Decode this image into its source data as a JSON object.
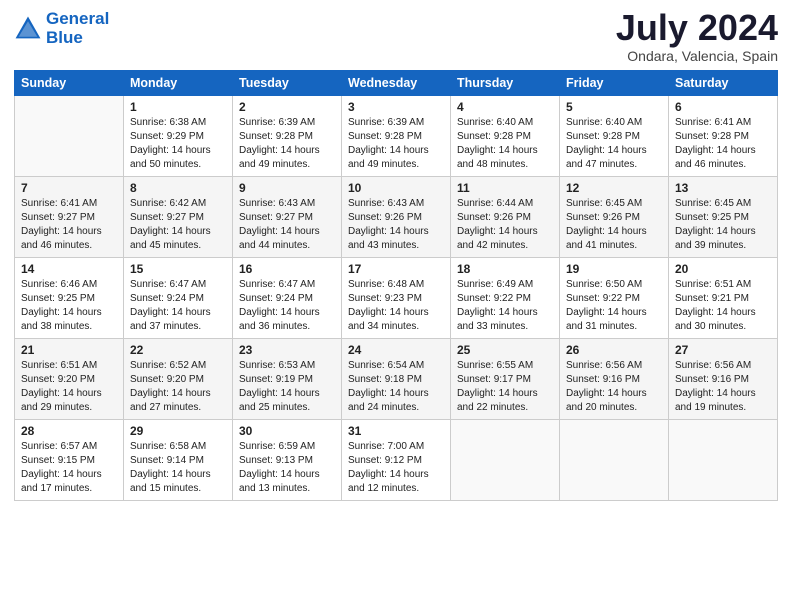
{
  "header": {
    "logo_line1": "General",
    "logo_line2": "Blue",
    "month": "July 2024",
    "location": "Ondara, Valencia, Spain"
  },
  "weekdays": [
    "Sunday",
    "Monday",
    "Tuesday",
    "Wednesday",
    "Thursday",
    "Friday",
    "Saturday"
  ],
  "weeks": [
    [
      {
        "day": "",
        "sunrise": "",
        "sunset": "",
        "daylight": ""
      },
      {
        "day": "1",
        "sunrise": "Sunrise: 6:38 AM",
        "sunset": "Sunset: 9:29 PM",
        "daylight": "Daylight: 14 hours and 50 minutes."
      },
      {
        "day": "2",
        "sunrise": "Sunrise: 6:39 AM",
        "sunset": "Sunset: 9:28 PM",
        "daylight": "Daylight: 14 hours and 49 minutes."
      },
      {
        "day": "3",
        "sunrise": "Sunrise: 6:39 AM",
        "sunset": "Sunset: 9:28 PM",
        "daylight": "Daylight: 14 hours and 49 minutes."
      },
      {
        "day": "4",
        "sunrise": "Sunrise: 6:40 AM",
        "sunset": "Sunset: 9:28 PM",
        "daylight": "Daylight: 14 hours and 48 minutes."
      },
      {
        "day": "5",
        "sunrise": "Sunrise: 6:40 AM",
        "sunset": "Sunset: 9:28 PM",
        "daylight": "Daylight: 14 hours and 47 minutes."
      },
      {
        "day": "6",
        "sunrise": "Sunrise: 6:41 AM",
        "sunset": "Sunset: 9:28 PM",
        "daylight": "Daylight: 14 hours and 46 minutes."
      }
    ],
    [
      {
        "day": "7",
        "sunrise": "Sunrise: 6:41 AM",
        "sunset": "Sunset: 9:27 PM",
        "daylight": "Daylight: 14 hours and 46 minutes."
      },
      {
        "day": "8",
        "sunrise": "Sunrise: 6:42 AM",
        "sunset": "Sunset: 9:27 PM",
        "daylight": "Daylight: 14 hours and 45 minutes."
      },
      {
        "day": "9",
        "sunrise": "Sunrise: 6:43 AM",
        "sunset": "Sunset: 9:27 PM",
        "daylight": "Daylight: 14 hours and 44 minutes."
      },
      {
        "day": "10",
        "sunrise": "Sunrise: 6:43 AM",
        "sunset": "Sunset: 9:26 PM",
        "daylight": "Daylight: 14 hours and 43 minutes."
      },
      {
        "day": "11",
        "sunrise": "Sunrise: 6:44 AM",
        "sunset": "Sunset: 9:26 PM",
        "daylight": "Daylight: 14 hours and 42 minutes."
      },
      {
        "day": "12",
        "sunrise": "Sunrise: 6:45 AM",
        "sunset": "Sunset: 9:26 PM",
        "daylight": "Daylight: 14 hours and 41 minutes."
      },
      {
        "day": "13",
        "sunrise": "Sunrise: 6:45 AM",
        "sunset": "Sunset: 9:25 PM",
        "daylight": "Daylight: 14 hours and 39 minutes."
      }
    ],
    [
      {
        "day": "14",
        "sunrise": "Sunrise: 6:46 AM",
        "sunset": "Sunset: 9:25 PM",
        "daylight": "Daylight: 14 hours and 38 minutes."
      },
      {
        "day": "15",
        "sunrise": "Sunrise: 6:47 AM",
        "sunset": "Sunset: 9:24 PM",
        "daylight": "Daylight: 14 hours and 37 minutes."
      },
      {
        "day": "16",
        "sunrise": "Sunrise: 6:47 AM",
        "sunset": "Sunset: 9:24 PM",
        "daylight": "Daylight: 14 hours and 36 minutes."
      },
      {
        "day": "17",
        "sunrise": "Sunrise: 6:48 AM",
        "sunset": "Sunset: 9:23 PM",
        "daylight": "Daylight: 14 hours and 34 minutes."
      },
      {
        "day": "18",
        "sunrise": "Sunrise: 6:49 AM",
        "sunset": "Sunset: 9:22 PM",
        "daylight": "Daylight: 14 hours and 33 minutes."
      },
      {
        "day": "19",
        "sunrise": "Sunrise: 6:50 AM",
        "sunset": "Sunset: 9:22 PM",
        "daylight": "Daylight: 14 hours and 31 minutes."
      },
      {
        "day": "20",
        "sunrise": "Sunrise: 6:51 AM",
        "sunset": "Sunset: 9:21 PM",
        "daylight": "Daylight: 14 hours and 30 minutes."
      }
    ],
    [
      {
        "day": "21",
        "sunrise": "Sunrise: 6:51 AM",
        "sunset": "Sunset: 9:20 PM",
        "daylight": "Daylight: 14 hours and 29 minutes."
      },
      {
        "day": "22",
        "sunrise": "Sunrise: 6:52 AM",
        "sunset": "Sunset: 9:20 PM",
        "daylight": "Daylight: 14 hours and 27 minutes."
      },
      {
        "day": "23",
        "sunrise": "Sunrise: 6:53 AM",
        "sunset": "Sunset: 9:19 PM",
        "daylight": "Daylight: 14 hours and 25 minutes."
      },
      {
        "day": "24",
        "sunrise": "Sunrise: 6:54 AM",
        "sunset": "Sunset: 9:18 PM",
        "daylight": "Daylight: 14 hours and 24 minutes."
      },
      {
        "day": "25",
        "sunrise": "Sunrise: 6:55 AM",
        "sunset": "Sunset: 9:17 PM",
        "daylight": "Daylight: 14 hours and 22 minutes."
      },
      {
        "day": "26",
        "sunrise": "Sunrise: 6:56 AM",
        "sunset": "Sunset: 9:16 PM",
        "daylight": "Daylight: 14 hours and 20 minutes."
      },
      {
        "day": "27",
        "sunrise": "Sunrise: 6:56 AM",
        "sunset": "Sunset: 9:16 PM",
        "daylight": "Daylight: 14 hours and 19 minutes."
      }
    ],
    [
      {
        "day": "28",
        "sunrise": "Sunrise: 6:57 AM",
        "sunset": "Sunset: 9:15 PM",
        "daylight": "Daylight: 14 hours and 17 minutes."
      },
      {
        "day": "29",
        "sunrise": "Sunrise: 6:58 AM",
        "sunset": "Sunset: 9:14 PM",
        "daylight": "Daylight: 14 hours and 15 minutes."
      },
      {
        "day": "30",
        "sunrise": "Sunrise: 6:59 AM",
        "sunset": "Sunset: 9:13 PM",
        "daylight": "Daylight: 14 hours and 13 minutes."
      },
      {
        "day": "31",
        "sunrise": "Sunrise: 7:00 AM",
        "sunset": "Sunset: 9:12 PM",
        "daylight": "Daylight: 14 hours and 12 minutes."
      },
      {
        "day": "",
        "sunrise": "",
        "sunset": "",
        "daylight": ""
      },
      {
        "day": "",
        "sunrise": "",
        "sunset": "",
        "daylight": ""
      },
      {
        "day": "",
        "sunrise": "",
        "sunset": "",
        "daylight": ""
      }
    ]
  ]
}
